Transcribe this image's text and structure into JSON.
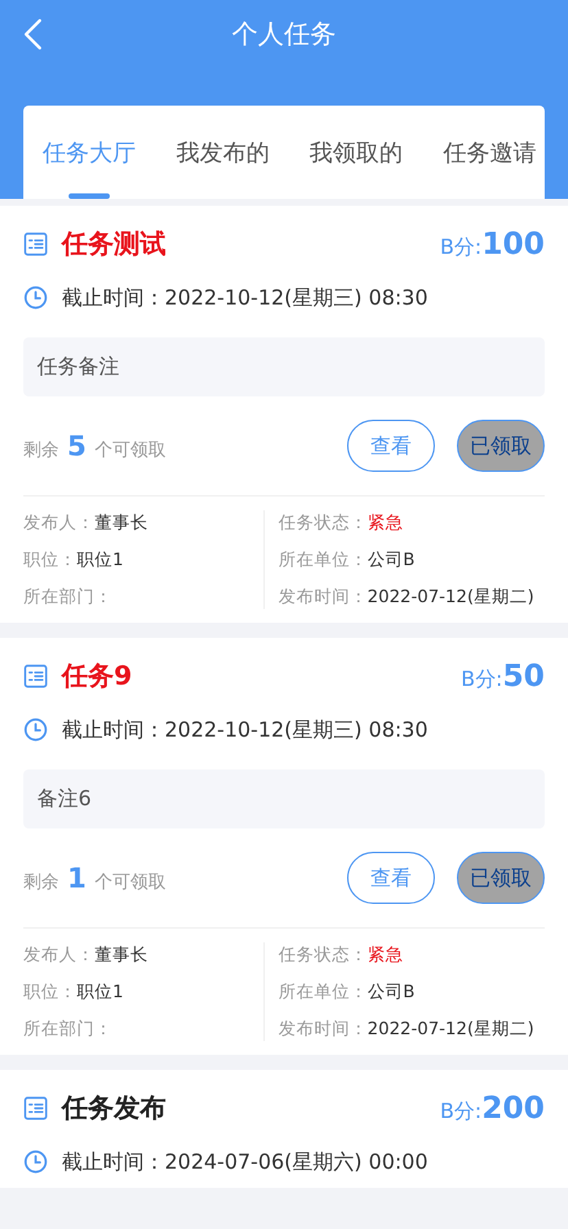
{
  "header": {
    "title": "个人任务"
  },
  "tabs": [
    {
      "label": "任务大厅",
      "selected": true
    },
    {
      "label": "我发布的",
      "selected": false
    },
    {
      "label": "我领取的",
      "selected": false
    },
    {
      "label": "任务邀请",
      "selected": false
    }
  ],
  "tasks": [
    {
      "title": "任务测试",
      "highlighted": true,
      "points_label": "B分:",
      "points": "100",
      "deadline": "截止时间：2022-10-12(星期三) 08:30",
      "note": "任务备注",
      "remaining_prefix": "剩余",
      "remaining": "5",
      "remaining_suffix": "个可领取",
      "view_button": "查看",
      "claim_button": "已领取",
      "claimed": true,
      "info_left": [
        {
          "label": "发布人：",
          "value": "董事长"
        },
        {
          "label": "职位：",
          "value": "职位1"
        },
        {
          "label": "所在部门："
        }
      ],
      "info_right": [
        {
          "label": "任务状态：",
          "value": "紧急",
          "alert": true
        },
        {
          "label": "所在单位：",
          "value": "公司B",
          "alert": false
        },
        {
          "label": "发布时间：",
          "value": "2022-07-12(星期二)",
          "alert": false
        }
      ]
    },
    {
      "title": "任务9",
      "highlighted": true,
      "points_label": "B分:",
      "points": "50",
      "deadline": "截止时间：2022-10-12(星期三) 08:30",
      "note": "备注6",
      "remaining_prefix": "剩余",
      "remaining": "1",
      "remaining_suffix": "个可领取",
      "view_button": "查看",
      "claim_button": "已领取",
      "claimed": true,
      "info_left": [
        {
          "label": "发布人：",
          "value": "董事长"
        },
        {
          "label": "职位：",
          "value": "职位1"
        },
        {
          "label": "所在部门："
        }
      ],
      "info_right": [
        {
          "label": "任务状态：",
          "value": "紧急",
          "alert": true
        },
        {
          "label": "所在单位：",
          "value": "公司B",
          "alert": false
        },
        {
          "label": "发布时间：",
          "value": "2022-07-12(星期二)",
          "alert": false
        }
      ]
    },
    {
      "title": "任务发布",
      "highlighted": false,
      "points_label": "B分:",
      "points": "200",
      "deadline": "截止时间：2024-07-06(星期六) 00:00"
    }
  ]
}
